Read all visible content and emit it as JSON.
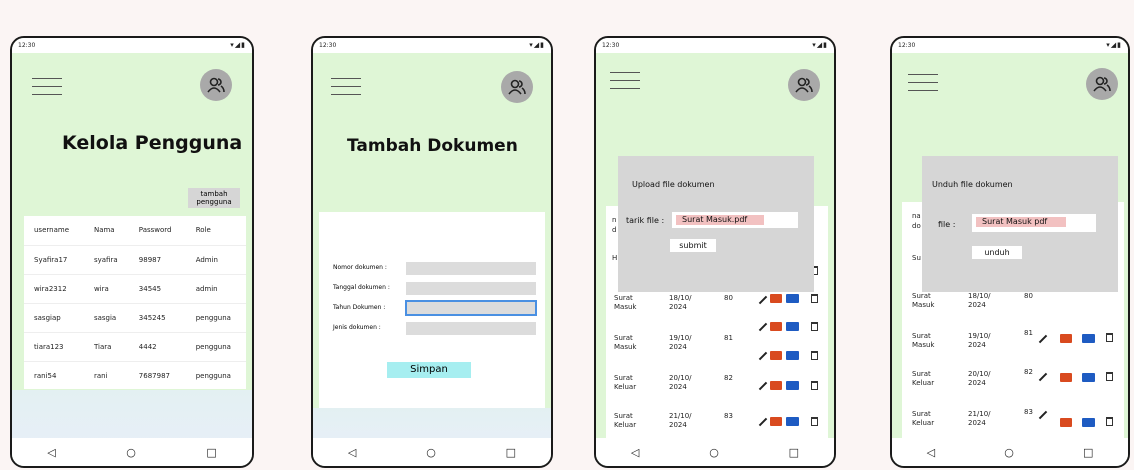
{
  "status": {
    "time": "12:30",
    "icons": "▾◢▮"
  },
  "nav": {
    "back": "◁",
    "home": "○",
    "recent": "□"
  },
  "screen1": {
    "title": "Kelola Pengguna",
    "add_button": "tambah pengguna",
    "columns": [
      "username",
      "Nama",
      "Password",
      "Role"
    ],
    "rows": [
      [
        "Syafira17",
        "syafira",
        "98987",
        "Admin"
      ],
      [
        "wira2312",
        "wira",
        "34545",
        "admin"
      ],
      [
        "sasgiap",
        "sasgia",
        "345245",
        "pengguna"
      ],
      [
        "tiara123",
        "Tiara",
        "4442",
        "pengguna"
      ],
      [
        "rani54",
        "rani",
        "7687987",
        "pengguna"
      ]
    ]
  },
  "screen2": {
    "title": "Tambah Dokumen",
    "fields": [
      {
        "label": "Nomor dokumen :",
        "value": ""
      },
      {
        "label": "Tanggal dokumen :",
        "value": ""
      },
      {
        "label": "Tahun Dokumen :",
        "value": ""
      },
      {
        "label": "Jenis dokumen :",
        "value": ""
      }
    ],
    "save_button": "Simpan"
  },
  "screen3": {
    "dialog_title": "Upload file dokumen",
    "file_label": "tarik file :",
    "file_value": "Surat Masuk.pdf",
    "submit_button": "submit",
    "peek_1": "n",
    "peek_2": "d",
    "peek_3": "H",
    "rows": [
      {
        "type": "Surat Masuk",
        "date": "18/10/ 2024",
        "num": "80"
      },
      {
        "type": "Surat Masuk",
        "date": "19/10/ 2024",
        "num": "81"
      },
      {
        "type": "Surat Keluar",
        "date": "20/10/ 2024",
        "num": "82"
      },
      {
        "type": "Surat Keluar",
        "date": "21/10/ 2024",
        "num": "83"
      }
    ]
  },
  "screen4": {
    "dialog_title": "Unduh file dokumen",
    "file_label": "file :",
    "file_value": "Surat Masuk pdf",
    "download_button": "unduh",
    "peek_1": "na",
    "peek_2": "do",
    "peek_3": "Su",
    "rows": [
      {
        "type": "Surat Masuk",
        "date": "18/10/ 2024",
        "num": "80"
      },
      {
        "type": "Surat Masuk",
        "date": "19/10/ 2024",
        "num": "81"
      },
      {
        "type": "Surat Keluar",
        "date": "20/10/ 2024",
        "num": "82"
      },
      {
        "type": "Surat Keluar",
        "date": "21/10/ 2024",
        "num": "83"
      }
    ]
  },
  "colors": {
    "phone_bg": "#dff6d6",
    "dialog_bg": "#d6d6d6",
    "file_chip": "#f2c1c1",
    "save_button": "#a6eef0",
    "focus_border": "#4a90e2"
  }
}
